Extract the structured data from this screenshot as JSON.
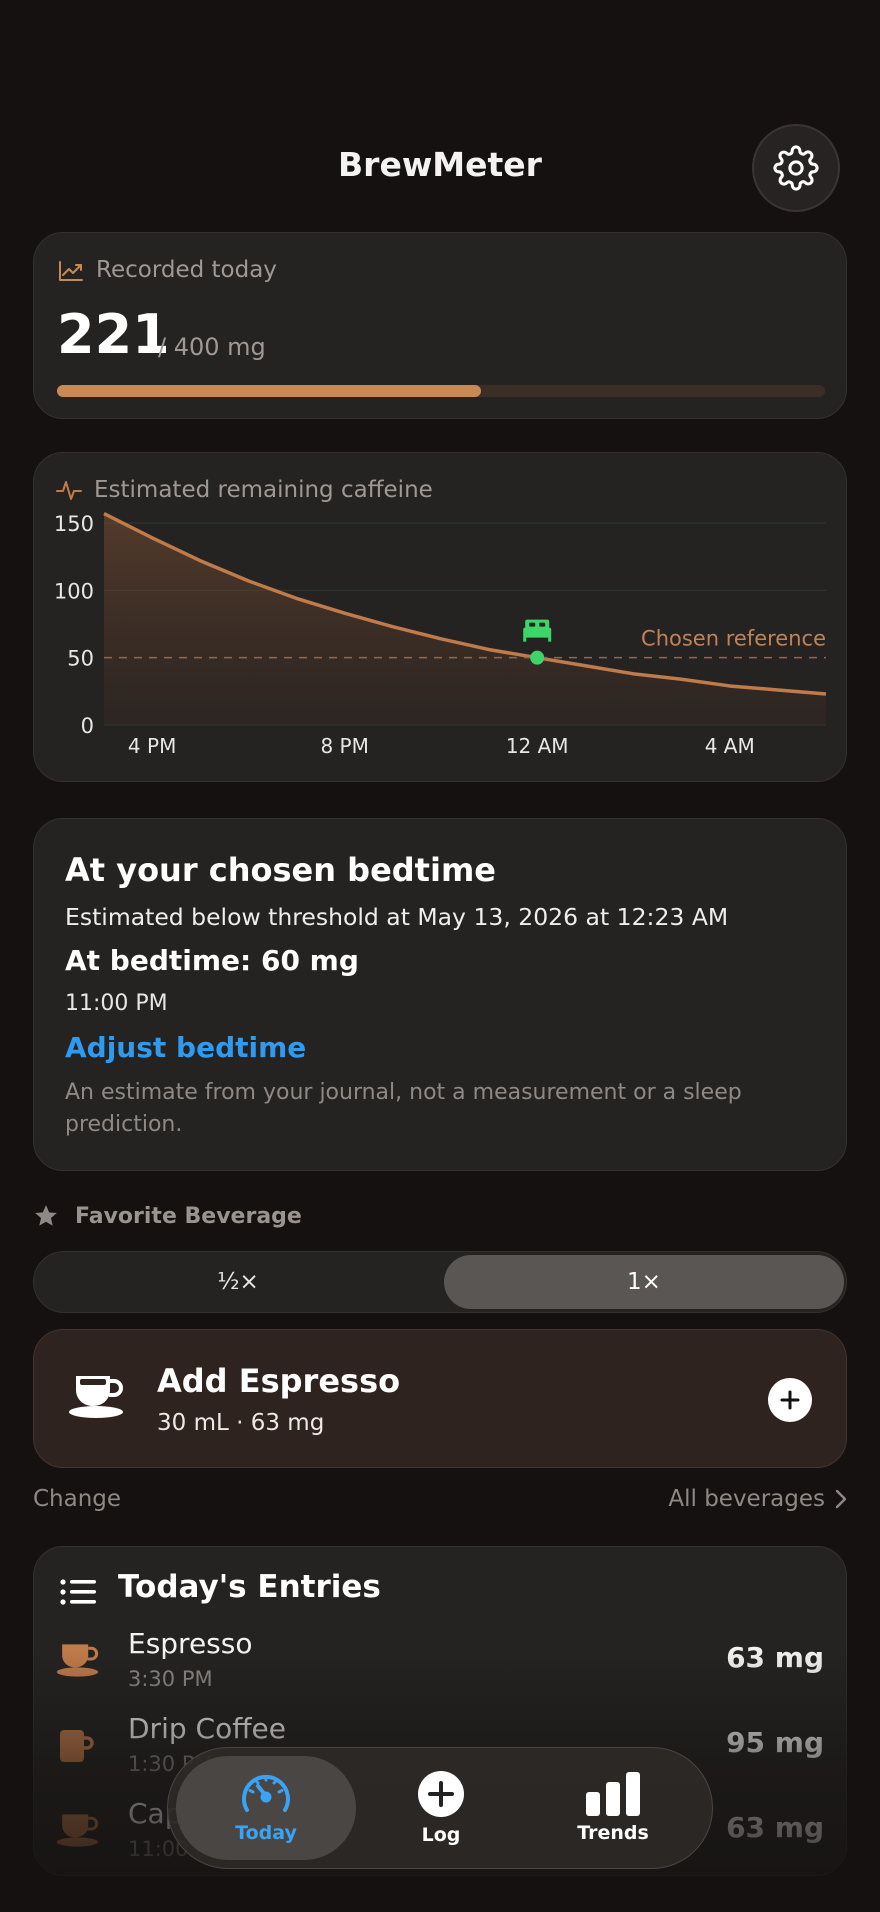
{
  "header": {
    "title": "BrewMeter",
    "settings_icon": "gear-icon"
  },
  "recorded": {
    "label": "Recorded today",
    "value": "221",
    "limit": "/ 400 mg",
    "progress": 0.5525,
    "accent": "#c88a55"
  },
  "chart_data": {
    "type": "area",
    "title": "Estimated remaining caffeine",
    "y_ticks": [
      "150",
      "100",
      "50",
      "0"
    ],
    "x_ticks": [
      "4 PM",
      "8 PM",
      "12 AM",
      "4 AM"
    ],
    "ylim": [
      0,
      150
    ],
    "x_hours_start": "4 PM",
    "x": [
      15.0,
      16.0,
      17.0,
      18.0,
      19.0,
      20.0,
      21.0,
      22.0,
      23.0,
      24.0,
      25.0,
      26.0,
      27.0,
      28.0,
      29.0,
      30.0
    ],
    "values": [
      157,
      139,
      122,
      107,
      94,
      83,
      73,
      64,
      56,
      50,
      44,
      38,
      34,
      29,
      26,
      23
    ],
    "reference_value": 50,
    "reference_label": "Chosen reference",
    "marker_x": 24.0,
    "marker_icon": "bed-icon",
    "grid": true,
    "line_color": "#c07b4a",
    "marker_color": "#3dd56a"
  },
  "bedtime": {
    "title": "At your chosen bedtime",
    "estimate": "Estimated below threshold at May 13, 2026 at 12:23 AM",
    "at_bedtime": "At bedtime: 60 mg",
    "time": "11:00 PM",
    "adjust": "Adjust bedtime",
    "note": "An estimate from your journal, not a measurement or a sleep prediction."
  },
  "favorite": {
    "label": "Favorite Beverage",
    "options": [
      "½×",
      "1×"
    ],
    "selected": "1×"
  },
  "add": {
    "title": "Add Espresso",
    "subtitle": "30 mL · 63 mg"
  },
  "links": {
    "change": "Change",
    "all_beverages": "All beverages"
  },
  "entries": {
    "title": "Today's Entries",
    "items": [
      {
        "name": "Espresso",
        "time": "3:30 PM",
        "mg": "63 mg",
        "icon": "espresso-cup-icon"
      },
      {
        "name": "Drip Coffee",
        "time": "1:30 PM",
        "mg": "95 mg",
        "icon": "mug-icon"
      },
      {
        "name": "Cappuccino",
        "time": "11:00 AM",
        "mg": "63 mg",
        "icon": "espresso-cup-icon"
      }
    ]
  },
  "tabs": [
    {
      "label": "Today",
      "icon": "speedometer-icon",
      "active": true
    },
    {
      "label": "Log",
      "icon": "plus-circle-icon",
      "active": false
    },
    {
      "label": "Trends",
      "icon": "bar-chart-icon",
      "active": false
    }
  ]
}
